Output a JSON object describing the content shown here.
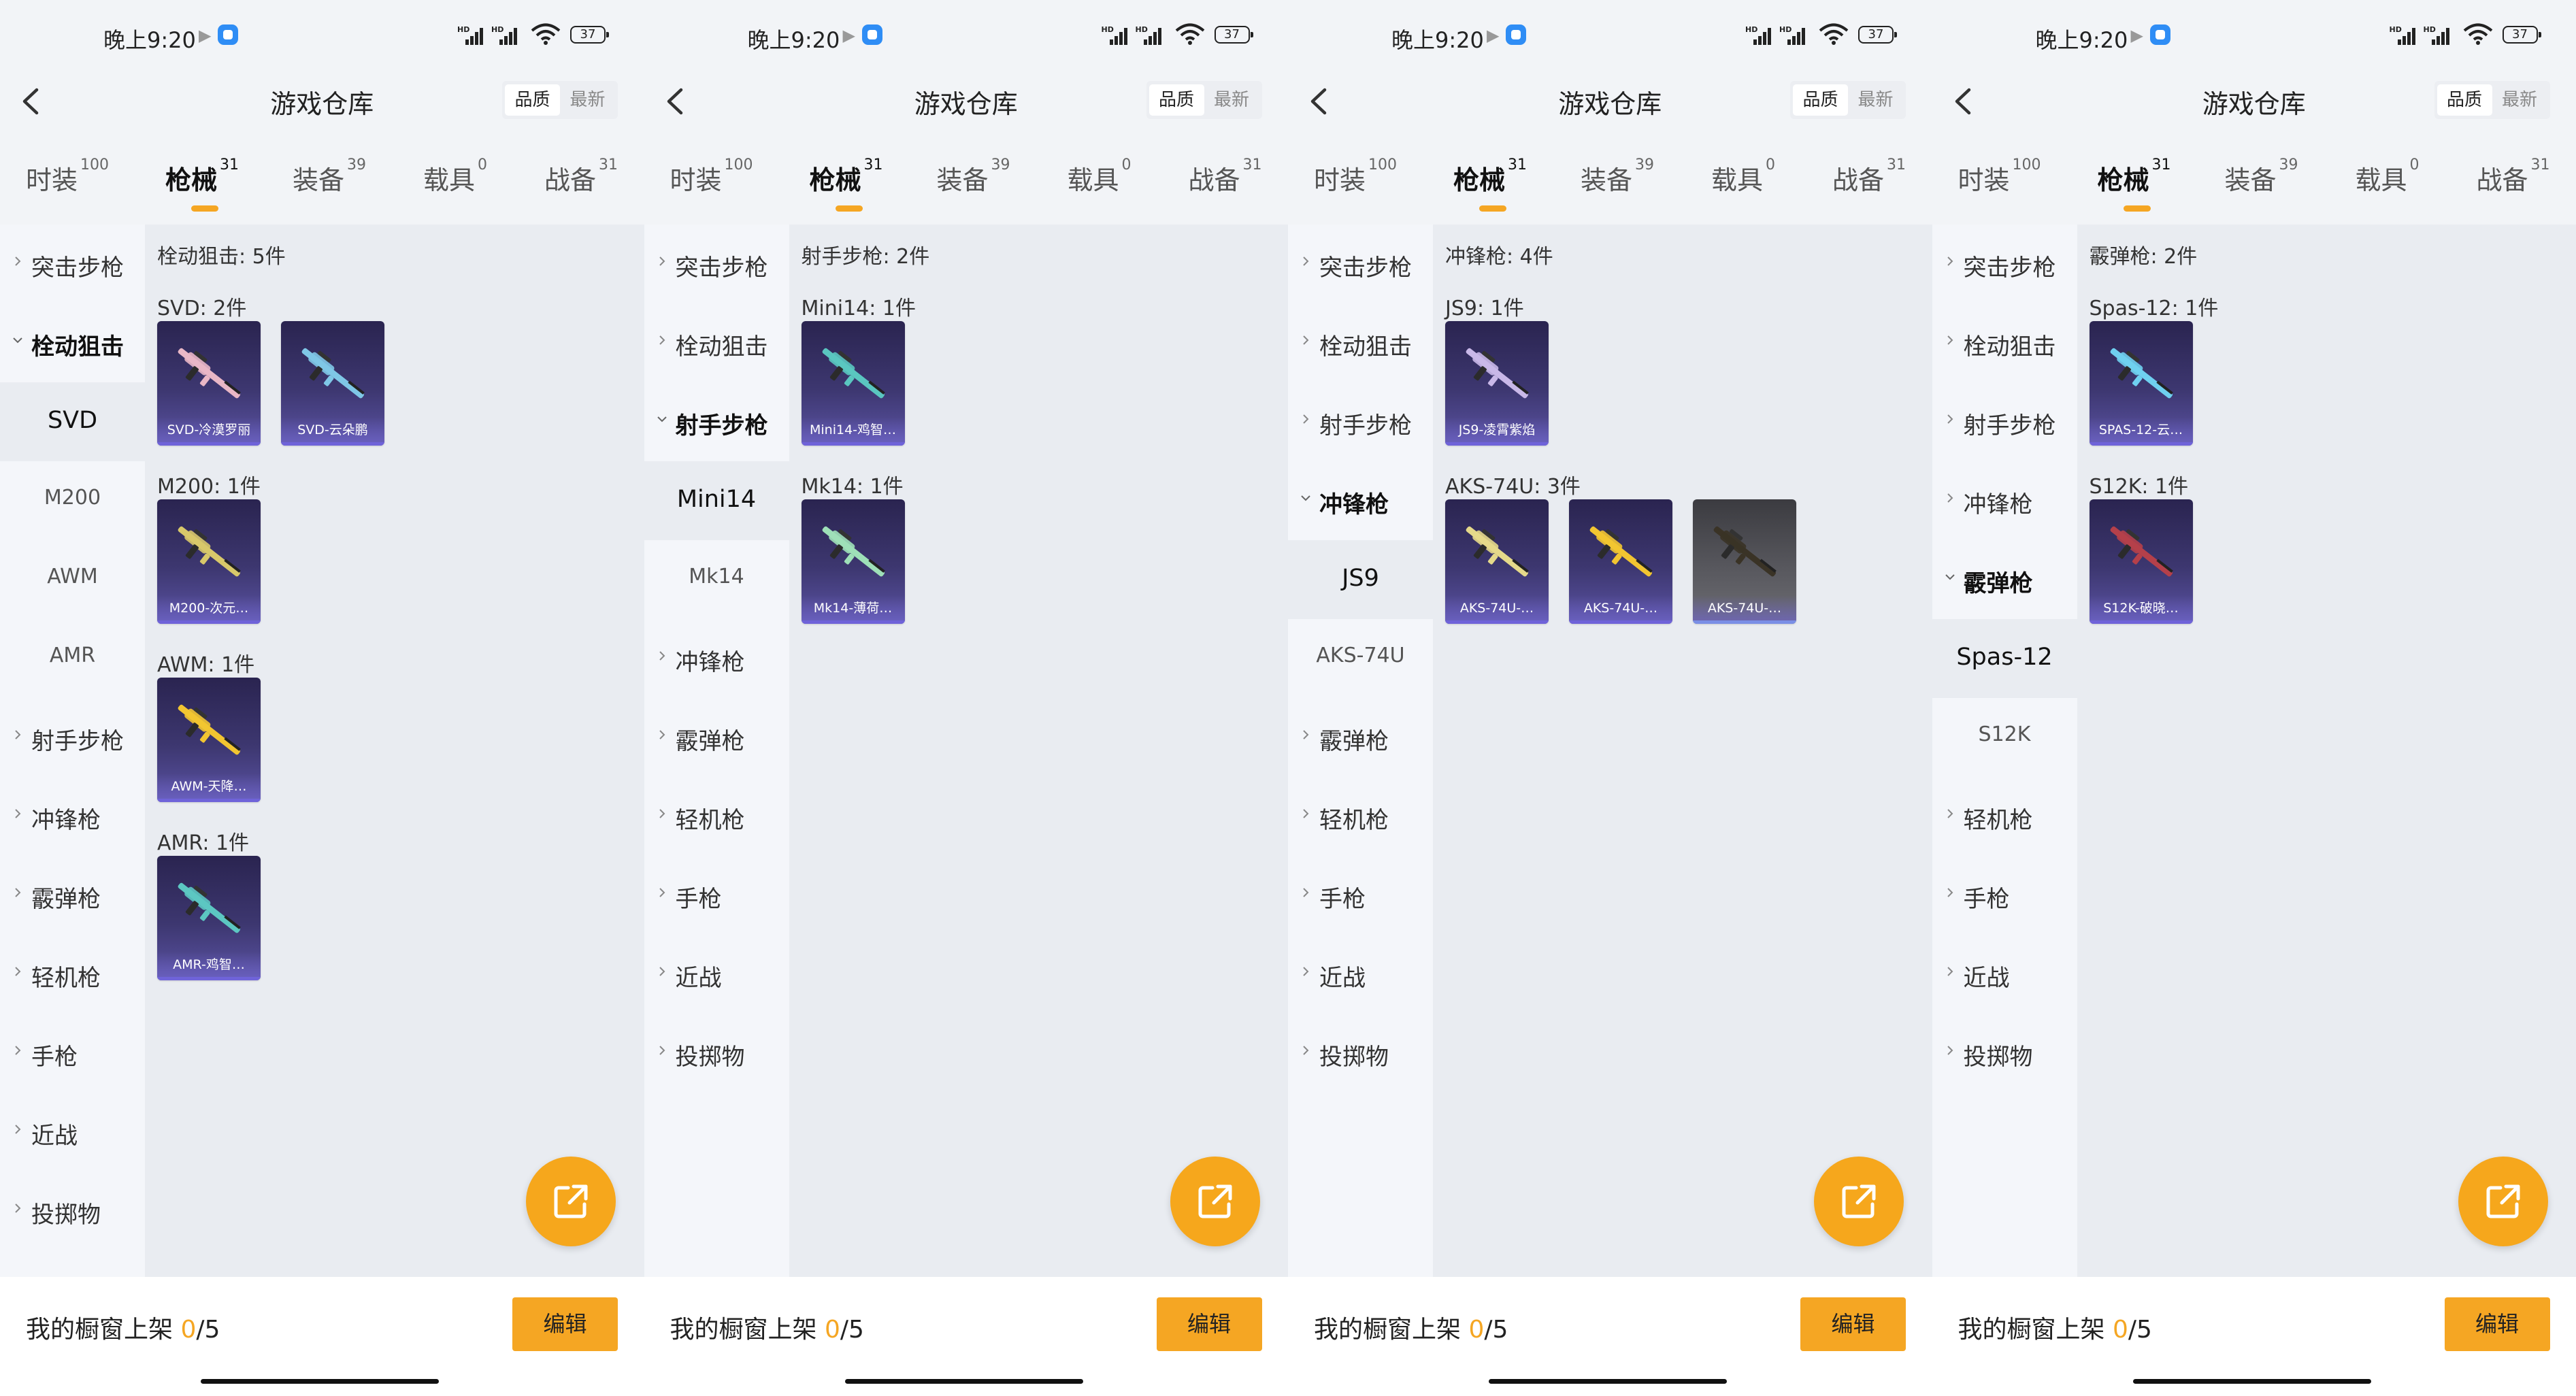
{
  "status_bar": {
    "time": "晚上9:20",
    "battery": "37"
  },
  "header": {
    "title": "游戏仓库",
    "sort_quality": "品质",
    "sort_newest": "最新"
  },
  "tabs": [
    {
      "label": "时装",
      "count": "100"
    },
    {
      "label": "枪械",
      "count": "31"
    },
    {
      "label": "装备",
      "count": "39"
    },
    {
      "label": "载具",
      "count": "0"
    },
    {
      "label": "战备",
      "count": "31"
    }
  ],
  "bottom": {
    "label": "我的橱窗上架",
    "count": "0",
    "total": "/5",
    "edit": "编辑"
  },
  "panels": [
    {
      "side": [
        {
          "label": "突击步枪",
          "kind": "collapsed"
        },
        {
          "label": "栓动狙击",
          "kind": "open"
        },
        {
          "label": "SVD",
          "kind": "sub-selected"
        },
        {
          "label": "M200",
          "kind": "sub"
        },
        {
          "label": "AWM",
          "kind": "sub"
        },
        {
          "label": "AMR",
          "kind": "sub"
        },
        {
          "label": "射手步枪",
          "kind": "collapsed"
        },
        {
          "label": "冲锋枪",
          "kind": "collapsed"
        },
        {
          "label": "霰弹枪",
          "kind": "collapsed"
        },
        {
          "label": "轻机枪",
          "kind": "collapsed"
        },
        {
          "label": "手枪",
          "kind": "collapsed"
        },
        {
          "label": "近战",
          "kind": "collapsed"
        },
        {
          "label": "投掷物",
          "kind": "collapsed"
        }
      ],
      "category_title": "栓动狙击: 5件",
      "groups": [
        {
          "name": "SVD: 2件",
          "items": [
            {
              "label": "SVD-冷漠罗丽",
              "color": "#e9b7c6"
            },
            {
              "label": "SVD-云朵鹏",
              "color": "#7fc7e6"
            }
          ]
        },
        {
          "name": "M200: 1件",
          "items": [
            {
              "label": "M200-次元…",
              "color": "#d8c86a"
            }
          ]
        },
        {
          "name": "AWM: 1件",
          "items": [
            {
              "label": "AWM-天降…",
              "color": "#f2c531"
            }
          ]
        },
        {
          "name": "AMR: 1件",
          "items": [
            {
              "label": "AMR-鸡智…",
              "color": "#5cc7c2"
            }
          ]
        }
      ]
    },
    {
      "side": [
        {
          "label": "突击步枪",
          "kind": "collapsed"
        },
        {
          "label": "栓动狙击",
          "kind": "collapsed"
        },
        {
          "label": "射手步枪",
          "kind": "open"
        },
        {
          "label": "Mini14",
          "kind": "sub-selected"
        },
        {
          "label": "Mk14",
          "kind": "sub"
        },
        {
          "label": "冲锋枪",
          "kind": "collapsed"
        },
        {
          "label": "霰弹枪",
          "kind": "collapsed"
        },
        {
          "label": "轻机枪",
          "kind": "collapsed"
        },
        {
          "label": "手枪",
          "kind": "collapsed"
        },
        {
          "label": "近战",
          "kind": "collapsed"
        },
        {
          "label": "投掷物",
          "kind": "collapsed"
        }
      ],
      "category_title": "射手步枪: 2件",
      "groups": [
        {
          "name": "Mini14: 1件",
          "items": [
            {
              "label": "Mini14-鸡智…",
              "color": "#5ac6c0"
            }
          ]
        },
        {
          "name": "Mk14: 1件",
          "items": [
            {
              "label": "Mk14-薄荷…",
              "color": "#9ee0b8"
            }
          ]
        }
      ]
    },
    {
      "side": [
        {
          "label": "突击步枪",
          "kind": "collapsed"
        },
        {
          "label": "栓动狙击",
          "kind": "collapsed"
        },
        {
          "label": "射手步枪",
          "kind": "collapsed"
        },
        {
          "label": "冲锋枪",
          "kind": "open"
        },
        {
          "label": "JS9",
          "kind": "sub-selected"
        },
        {
          "label": "AKS-74U",
          "kind": "sub"
        },
        {
          "label": "霰弹枪",
          "kind": "collapsed"
        },
        {
          "label": "轻机枪",
          "kind": "collapsed"
        },
        {
          "label": "手枪",
          "kind": "collapsed"
        },
        {
          "label": "近战",
          "kind": "collapsed"
        },
        {
          "label": "投掷物",
          "kind": "collapsed"
        }
      ],
      "category_title": "冲锋枪: 4件",
      "groups": [
        {
          "name": "JS9: 1件",
          "items": [
            {
              "label": "JS9-凌霄紫焰",
              "color": "#c9b8e8"
            }
          ]
        },
        {
          "name": "AKS-74U: 3件",
          "items": [
            {
              "label": "AKS-74U-…",
              "color": "#e5d98a"
            },
            {
              "label": "AKS-74U-…",
              "color": "#f2c531"
            },
            {
              "label": "AKS-74U-…",
              "color": "#3a3326",
              "grey": true
            }
          ]
        }
      ]
    },
    {
      "side": [
        {
          "label": "突击步枪",
          "kind": "collapsed"
        },
        {
          "label": "栓动狙击",
          "kind": "collapsed"
        },
        {
          "label": "射手步枪",
          "kind": "collapsed"
        },
        {
          "label": "冲锋枪",
          "kind": "collapsed"
        },
        {
          "label": "霰弹枪",
          "kind": "open"
        },
        {
          "label": "Spas-12",
          "kind": "sub-selected"
        },
        {
          "label": "S12K",
          "kind": "sub"
        },
        {
          "label": "轻机枪",
          "kind": "collapsed"
        },
        {
          "label": "手枪",
          "kind": "collapsed"
        },
        {
          "label": "近战",
          "kind": "collapsed"
        },
        {
          "label": "投掷物",
          "kind": "collapsed"
        }
      ],
      "category_title": "霰弹枪: 2件",
      "groups": [
        {
          "name": "Spas-12: 1件",
          "items": [
            {
              "label": "SPAS-12-云…",
              "color": "#6fd0f0"
            }
          ]
        },
        {
          "name": "S12K: 1件",
          "items": [
            {
              "label": "S12K-破晓…",
              "color": "#b5404a"
            }
          ]
        }
      ]
    }
  ]
}
